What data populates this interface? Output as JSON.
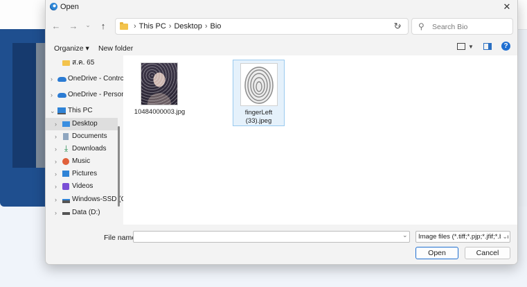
{
  "dialog": {
    "title": "Open",
    "close_glyph": "✕"
  },
  "nav": {
    "back_glyph": "←",
    "forward_glyph": "→",
    "recent_glyph": "⌄",
    "up_glyph": "↑",
    "breadcrumbs": [
      "This PC",
      "Desktop",
      "Bio"
    ],
    "crumb_sep": "›",
    "refresh_glyph": "↻",
    "search_placeholder": "Search Bio"
  },
  "toolbar": {
    "organize_label": "Organize ▾",
    "new_folder_label": "New folder",
    "help_glyph": "?"
  },
  "sidebar": {
    "items": [
      {
        "label": "ส.ค. 65",
        "chevron": "",
        "icon": "folder-icon"
      },
      {
        "label": "OneDrive - Contrc",
        "chevron": "›",
        "icon": "cloud-icon"
      },
      {
        "label": "OneDrive - Person",
        "chevron": "›",
        "icon": "cloud-icon"
      },
      {
        "label": "This PC",
        "chevron": "⌄",
        "icon": "pc-icon"
      },
      {
        "label": "Desktop",
        "chevron": "›",
        "icon": "desktop-icon"
      },
      {
        "label": "Documents",
        "chevron": "›",
        "icon": "documents-icon"
      },
      {
        "label": "Downloads",
        "chevron": "›",
        "icon": "downloads-icon"
      },
      {
        "label": "Music",
        "chevron": "›",
        "icon": "music-icon"
      },
      {
        "label": "Pictures",
        "chevron": "›",
        "icon": "pictures-icon"
      },
      {
        "label": "Videos",
        "chevron": "›",
        "icon": "videos-icon"
      },
      {
        "label": "Windows-SSD (C",
        "chevron": "›",
        "icon": "drive-icon"
      },
      {
        "label": "Data (D:)",
        "chevron": "›",
        "icon": "drive-icon"
      }
    ]
  },
  "files": [
    {
      "name": "10484000003.jpg",
      "kind": "photo-thumbnail"
    },
    {
      "name": "fingerLeft (33).jpeg",
      "kind": "fingerprint-thumbnail"
    }
  ],
  "footer": {
    "file_name_label": "File name:",
    "file_name_value": "",
    "file_type_value": "Image files (*.tiff;*.pjp;*.jfif;*.bm",
    "open_label": "Open",
    "cancel_label": "Cancel"
  },
  "colors": {
    "accent": "#1f6fd1",
    "selection": "#e5f1fb",
    "folder": "#f3c34c"
  }
}
